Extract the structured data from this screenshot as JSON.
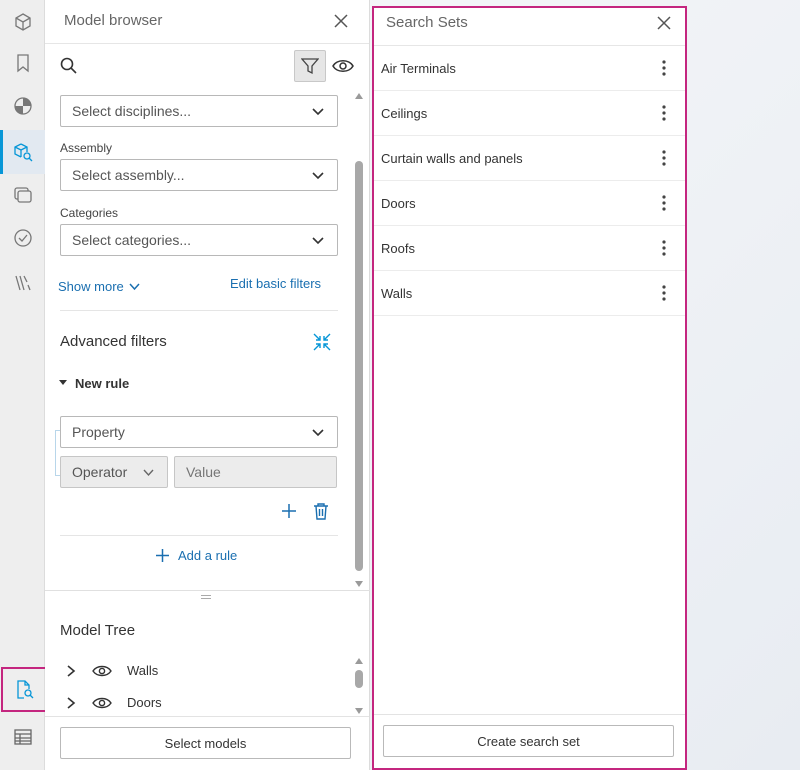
{
  "rail": {
    "items": [
      {
        "icon": "cube-icon"
      },
      {
        "icon": "bookmark-icon"
      },
      {
        "icon": "pie-chart-icon"
      },
      {
        "icon": "model-search-icon",
        "active": true
      },
      {
        "icon": "layers-icon"
      },
      {
        "icon": "check-circle-icon"
      },
      {
        "icon": "road-icon"
      },
      {
        "icon": "document-search-icon",
        "highlighted": true
      },
      {
        "icon": "table-icon"
      }
    ]
  },
  "browser": {
    "title": "Model browser",
    "filters": {
      "disciplines_placeholder": "Select disciplines...",
      "assembly_label": "Assembly",
      "assembly_placeholder": "Select assembly...",
      "categories_label": "Categories",
      "categories_placeholder": "Select categories...",
      "show_more": "Show more",
      "edit_basic_filters": "Edit basic filters"
    },
    "advanced": {
      "title": "Advanced filters",
      "rule_title": "New rule",
      "property_placeholder": "Property",
      "operator_placeholder": "Operator",
      "value_placeholder": "Value",
      "add_rule": "Add a rule"
    },
    "tree": {
      "title": "Model Tree",
      "items": [
        "Walls",
        "Doors"
      ]
    },
    "footer_button": "Select models"
  },
  "search_sets": {
    "title": "Search Sets",
    "items": [
      "Air Terminals",
      "Ceilings",
      "Curtain walls and panels",
      "Doors",
      "Roofs",
      "Walls"
    ],
    "footer_button": "Create search set"
  },
  "colors": {
    "accent": "#0696d7",
    "link": "#1a6fb0",
    "highlight": "#c4267f"
  }
}
